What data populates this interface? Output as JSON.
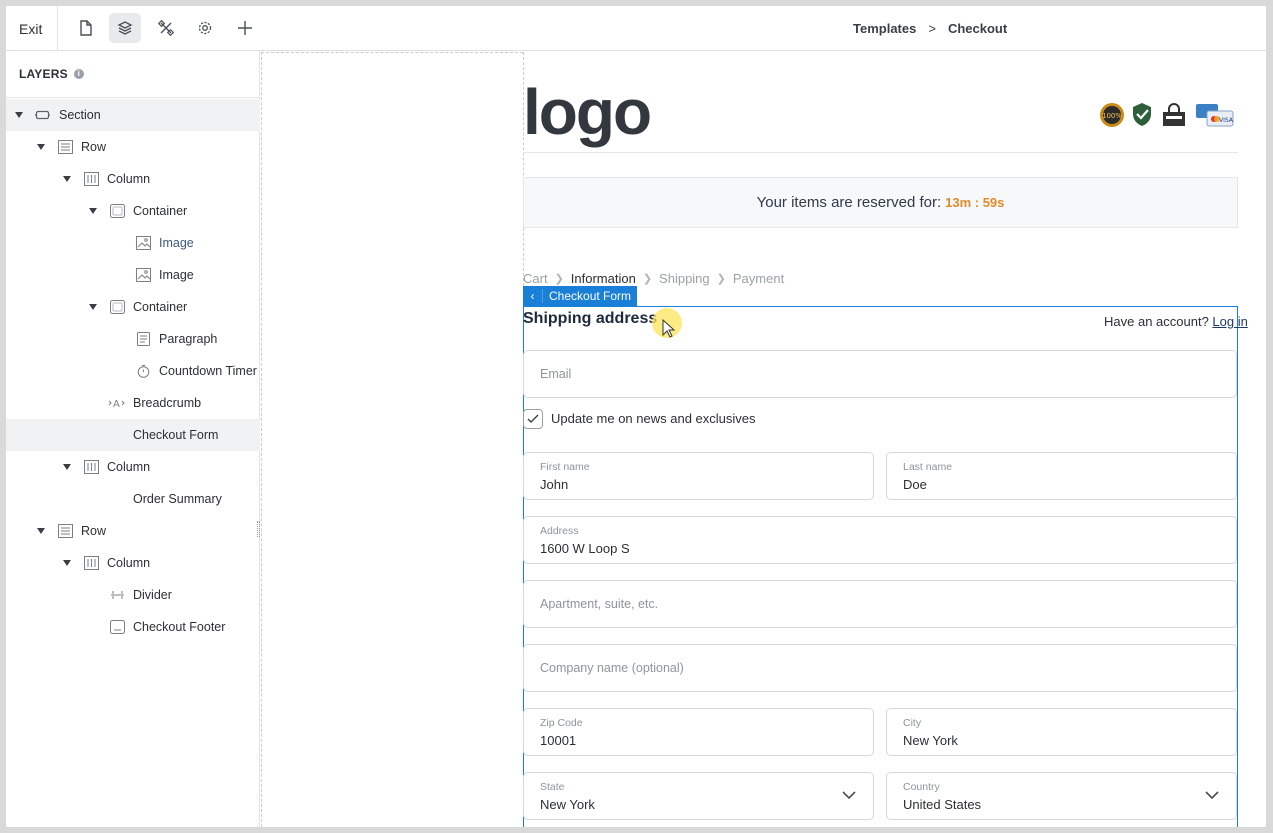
{
  "toolbar": {
    "exit_label": "Exit",
    "icons": [
      "page-icon",
      "layers-icon",
      "tools-icon",
      "settings-icon",
      "plus-icon"
    ]
  },
  "breadcrumb_top": {
    "parent": "Templates",
    "separator": ">",
    "current": "Checkout"
  },
  "layers": {
    "title": "LAYERS",
    "items": [
      {
        "label": "Section",
        "icon": "section-icon"
      },
      {
        "label": "Row",
        "icon": "row-icon"
      },
      {
        "label": "Column",
        "icon": "column-icon"
      },
      {
        "label": "Container",
        "icon": "container-icon"
      },
      {
        "label": "Image",
        "icon": "image-icon"
      },
      {
        "label": "Image",
        "icon": "image-icon"
      },
      {
        "label": "Container",
        "icon": "container-icon"
      },
      {
        "label": "Paragraph",
        "icon": "paragraph-icon"
      },
      {
        "label": "Countdown Timer",
        "icon": "timer-icon"
      },
      {
        "label": "Breadcrumb",
        "icon": "breadcrumb-icon"
      },
      {
        "label": "Checkout Form",
        "icon": ""
      },
      {
        "label": "Column",
        "icon": "column-icon"
      },
      {
        "label": "Order Summary",
        "icon": ""
      },
      {
        "label": "Row",
        "icon": "row-icon"
      },
      {
        "label": "Column",
        "icon": "column-icon"
      },
      {
        "label": "Divider",
        "icon": "divider-icon"
      },
      {
        "label": "Checkout Footer",
        "icon": "footer-icon"
      }
    ]
  },
  "page": {
    "logo_text": "logo",
    "timer": {
      "label": "Your items are reserved for:",
      "value": "13m : 59s"
    },
    "steps": [
      "Cart",
      "Information",
      "Shipping",
      "Payment"
    ],
    "selection_tag": "Checkout Form",
    "form": {
      "title": "Shipping address",
      "account_prompt": "Have an account?",
      "login_link": "Log in",
      "email_placeholder": "Email",
      "news_checkbox_label": "Update me on news and exclusives",
      "first_name": {
        "label": "First name",
        "value": "John"
      },
      "last_name": {
        "label": "Last name",
        "value": "Doe"
      },
      "address": {
        "label": "Address",
        "value": "1600 W Loop S"
      },
      "apartment_placeholder": "Apartment, suite, etc.",
      "company_placeholder": "Company name (optional)",
      "zip": {
        "label": "Zip Code",
        "value": "10001"
      },
      "city": {
        "label": "City",
        "value": "New York"
      },
      "state": {
        "label": "State",
        "value": "New York"
      },
      "country": {
        "label": "Country",
        "value": "United States"
      }
    }
  },
  "colors": {
    "accent": "#1a7fd6",
    "timer": "#e08a2b",
    "selected_layer_bg": "#f1f2f4"
  }
}
